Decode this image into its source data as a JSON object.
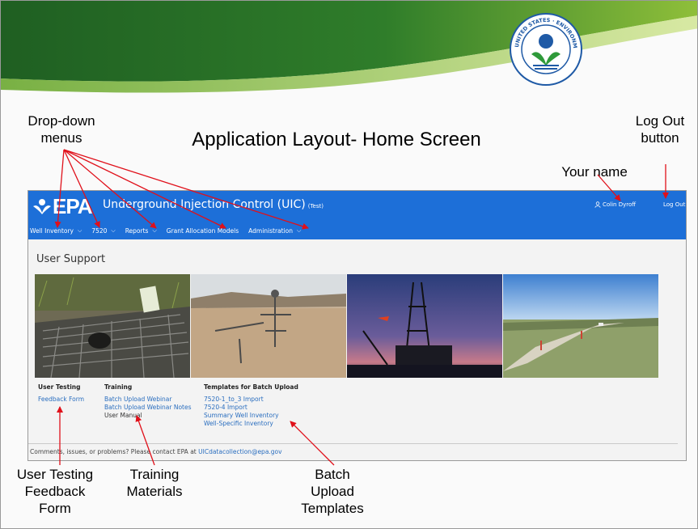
{
  "slide": {
    "title": "Application Layout- Home Screen",
    "labels": {
      "dropdown_menus": "Drop-down\nmenus",
      "logout_button": "Log Out\nbutton",
      "your_name": "Your name",
      "user_testing": "User Testing\nFeedback\nForm",
      "training_materials": "Training\nMaterials",
      "batch_templates": "Batch\nUpload\nTemplates"
    },
    "seal_text": "UNITED STATES ENVIRONMENTAL PROTECTION AGENCY"
  },
  "app": {
    "logo": "EPA",
    "title": "Underground Injection Control (UIC)",
    "title_tag": "(Test)",
    "user_name": "Colin Dyroff",
    "logout": "Log Out",
    "nav": [
      {
        "label": "Well Inventory"
      },
      {
        "label": "7520"
      },
      {
        "label": "Reports"
      },
      {
        "label": "Grant Allocation Models"
      },
      {
        "label": "Administration"
      }
    ],
    "page_heading": "User Support",
    "columns": {
      "user_testing": {
        "heading": "User Testing",
        "links": [
          "Feedback Form"
        ]
      },
      "training": {
        "heading": "Training",
        "links": [
          "Batch Upload Webinar",
          "Batch Upload Webinar Notes"
        ],
        "text": "User Manual"
      },
      "templates": {
        "heading": "Templates for Batch Upload",
        "links": [
          "7520-1_to_3 Import",
          "7520-4 Import",
          "Summary Well Inventory",
          "Well-Specific Inventory"
        ]
      }
    },
    "footer_text": "Comments, issues, or problems? Please contact EPA at ",
    "footer_email": "UICdatacollection@epa.gov"
  },
  "colors": {
    "app_blue": "#1d6fd8",
    "arrow_red": "#e0101a",
    "link_blue": "#2a6ebf",
    "header_green_dark": "#2f7d2a",
    "header_green_light": "#a9cc3a"
  }
}
